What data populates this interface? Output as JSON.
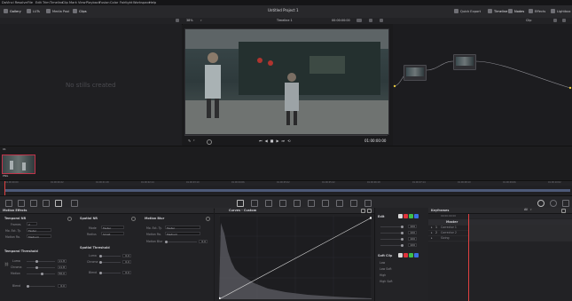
{
  "app": {
    "menu": [
      "DaVinci Resolve",
      "File",
      "Edit",
      "Trim",
      "Timeline",
      "Clip",
      "Mark",
      "View",
      "Playback",
      "Fusion",
      "Color",
      "Fairlight",
      "Workspace",
      "Help"
    ]
  },
  "toolbar": {
    "gallery": "Gallery",
    "luts": "LUTs",
    "media_pool": "Media Pool",
    "clips": "Clips",
    "project_title": "Untitled Project 1",
    "quick_export": "Quick Export",
    "timeline": "Timeline",
    "nodes": "Nodes",
    "effects": "Effects",
    "lightbox": "Lightbox"
  },
  "viewer_bar": {
    "zoom": "38%",
    "timeline_name": "Timeline 1",
    "timecode": "00:00:00:00",
    "clip_mode": "Clip"
  },
  "gallery": {
    "empty_text": "No stills created"
  },
  "viewer": {
    "playback_timecode": "01:00:00:00"
  },
  "clips": {
    "clip_number": "01",
    "clip_codec": "PNG"
  },
  "timeline_ruler": [
    "01:00:00:00",
    "01:00:00:22",
    "01:00:01:18",
    "01:00:02:14",
    "01:00:03:10",
    "01:00:04:06",
    "01:00:05:02",
    "01:00:05:22",
    "01:00:06:18",
    "01:00:07:14",
    "01:00:08:10",
    "01:00:09:06",
    "01:00:10:02"
  ],
  "motion_effects": {
    "title": "Motion Effects",
    "temporal_nr": {
      "header": "Temporal NR",
      "frames_label": "Frames",
      "frames_value": "2",
      "mo_est_label": "Mo. Est. Ty.",
      "mo_est_value": "Faster",
      "motion_range_label": "Motion Ra.",
      "motion_range_value": "Medium"
    },
    "temporal_threshold": {
      "header": "Temporal Threshold",
      "luma_label": "Luma",
      "luma_value": "11.8",
      "chroma_label": "Chroma",
      "chroma_value": "11.8",
      "motion_label": "Motion",
      "motion_value": "50.0",
      "blend_label": "Blend",
      "blend_value": "0.0"
    },
    "spatial_nr": {
      "header": "Spatial NR",
      "mode_label": "Mode",
      "mode_value": "Faster",
      "radius_label": "Radius",
      "radius_value": "Small"
    },
    "spatial_threshold": {
      "header": "Spatial Threshold",
      "luma_label": "Luma",
      "luma_value": "0.0",
      "chroma_label": "Chroma",
      "chroma_value": "0.0",
      "blend_label": "Blend",
      "blend_value": "0.0"
    },
    "motion_blur": {
      "header": "Motion Blur",
      "mo_est_label": "Mo. Est. Ty.",
      "mo_est_value": "Faster",
      "motion_range_label": "Motion Ra.",
      "motion_range_value": "Medium",
      "motion_blur_label": "Motion Blur",
      "motion_blur_value": "0.0"
    }
  },
  "curves": {
    "title": "Curves - Custom",
    "edit_label": "Edit",
    "soft_clip_label": "Soft Clip",
    "channel_values": [
      "100",
      "100",
      "100",
      "100"
    ],
    "soft_clip_rows": [
      "Low",
      "Low Soft",
      "High",
      "High Soft"
    ],
    "colors": {
      "red": "#e0333a",
      "green": "#3fbf4a",
      "blue": "#3a6fe0",
      "white": "#d8d8d8"
    }
  },
  "keyframes": {
    "title": "Keyframes",
    "mode": "All",
    "master_label": "Master",
    "rows": [
      "Corrector 1",
      "Corrector 2",
      "Sizing"
    ],
    "timecode": "00:00:00:00"
  }
}
